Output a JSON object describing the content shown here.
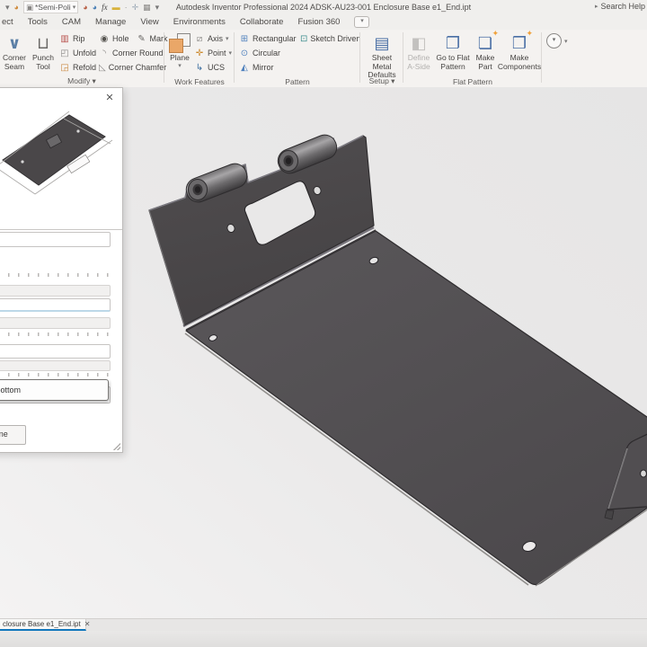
{
  "titlebar": {
    "appearance_value": "*Semi-Poli",
    "fx_label": "fx",
    "app_title": "Autodesk Inventor Professional 2024    ADSK-AU23-001 Enclosure Base e1_End.ipt",
    "search_help": "Search Help"
  },
  "menubar": {
    "tabs": [
      "ect",
      "Tools",
      "CAM",
      "Manage",
      "View",
      "Environments",
      "Collaborate",
      "Fusion 360"
    ]
  },
  "ribbon": {
    "modify": {
      "corner_seam": "Corner Seam",
      "punch_tool": "Punch Tool",
      "rip": "Rip",
      "unfold": "Unfold",
      "refold": "Refold",
      "hole": "Hole",
      "mark": "Mark",
      "corner_round": "Corner Round",
      "corner_chamfer": "Corner Chamfer",
      "group_label": "Modify ▾"
    },
    "work_features": {
      "plane": "Plane",
      "axis": "Axis",
      "point": "Point",
      "ucs": "UCS",
      "group_label": "Work Features"
    },
    "pattern": {
      "rectangular": "Rectangular",
      "circular": "Circular",
      "mirror": "Mirror",
      "sketch_driven": "Sketch Driven",
      "group_label": "Pattern"
    },
    "setup": {
      "sheet_metal_defaults": "Sheet Metal Defaults",
      "group_label": "Setup ▾"
    },
    "flat_pattern": {
      "define_a_side": "Define A-Side",
      "go_to_flat_pattern": "Go to Flat Pattern",
      "make_part": "Make Part",
      "make_components": "Make Components",
      "group_label": "Flat Pattern"
    }
  },
  "panel": {
    "close_glyph": "✕",
    "tooltip_text": "p to bottom",
    "done_label": "Done"
  },
  "tabbar": {
    "active_tab_label": "closure Base e1_End.ipt",
    "close_glyph": "✕"
  },
  "icons": {
    "corner_seam": "∨",
    "punch_tool": "⊔",
    "rip": "▥",
    "unfold": "◰",
    "refold": "◲",
    "hole": "◉",
    "mark": "✎",
    "corner_round": "◝",
    "corner_chamfer": "◺",
    "axis": "⧄",
    "point": "✛",
    "ucs": "↳",
    "rectangular": "⊞",
    "circular": "⊙",
    "mirror": "◭",
    "sketch_driven": "⊡",
    "sheet_metal_defaults": "▤",
    "define_a_side": "◧",
    "go_to_flat_pattern": "❐",
    "make_part": "❏",
    "make_components": "❒",
    "star": "✦",
    "qat_caret": "▾",
    "color_wheel_1": "◕",
    "image_thumb": "▣",
    "color_wheel_2": "◕",
    "color_wheel_3": "◕",
    "swatch": "▬",
    "dot": "·",
    "move_cross": "✛",
    "grid": "▦",
    "caret_down": "▾",
    "caret_right": "▸"
  },
  "colors": {
    "accent_blue": "#1076bc",
    "plane_orange": "#eaa768",
    "part_wall_gray": "#4b4849",
    "part_base_gray": "#555255",
    "viewport_bg": "#e9e8e8"
  }
}
